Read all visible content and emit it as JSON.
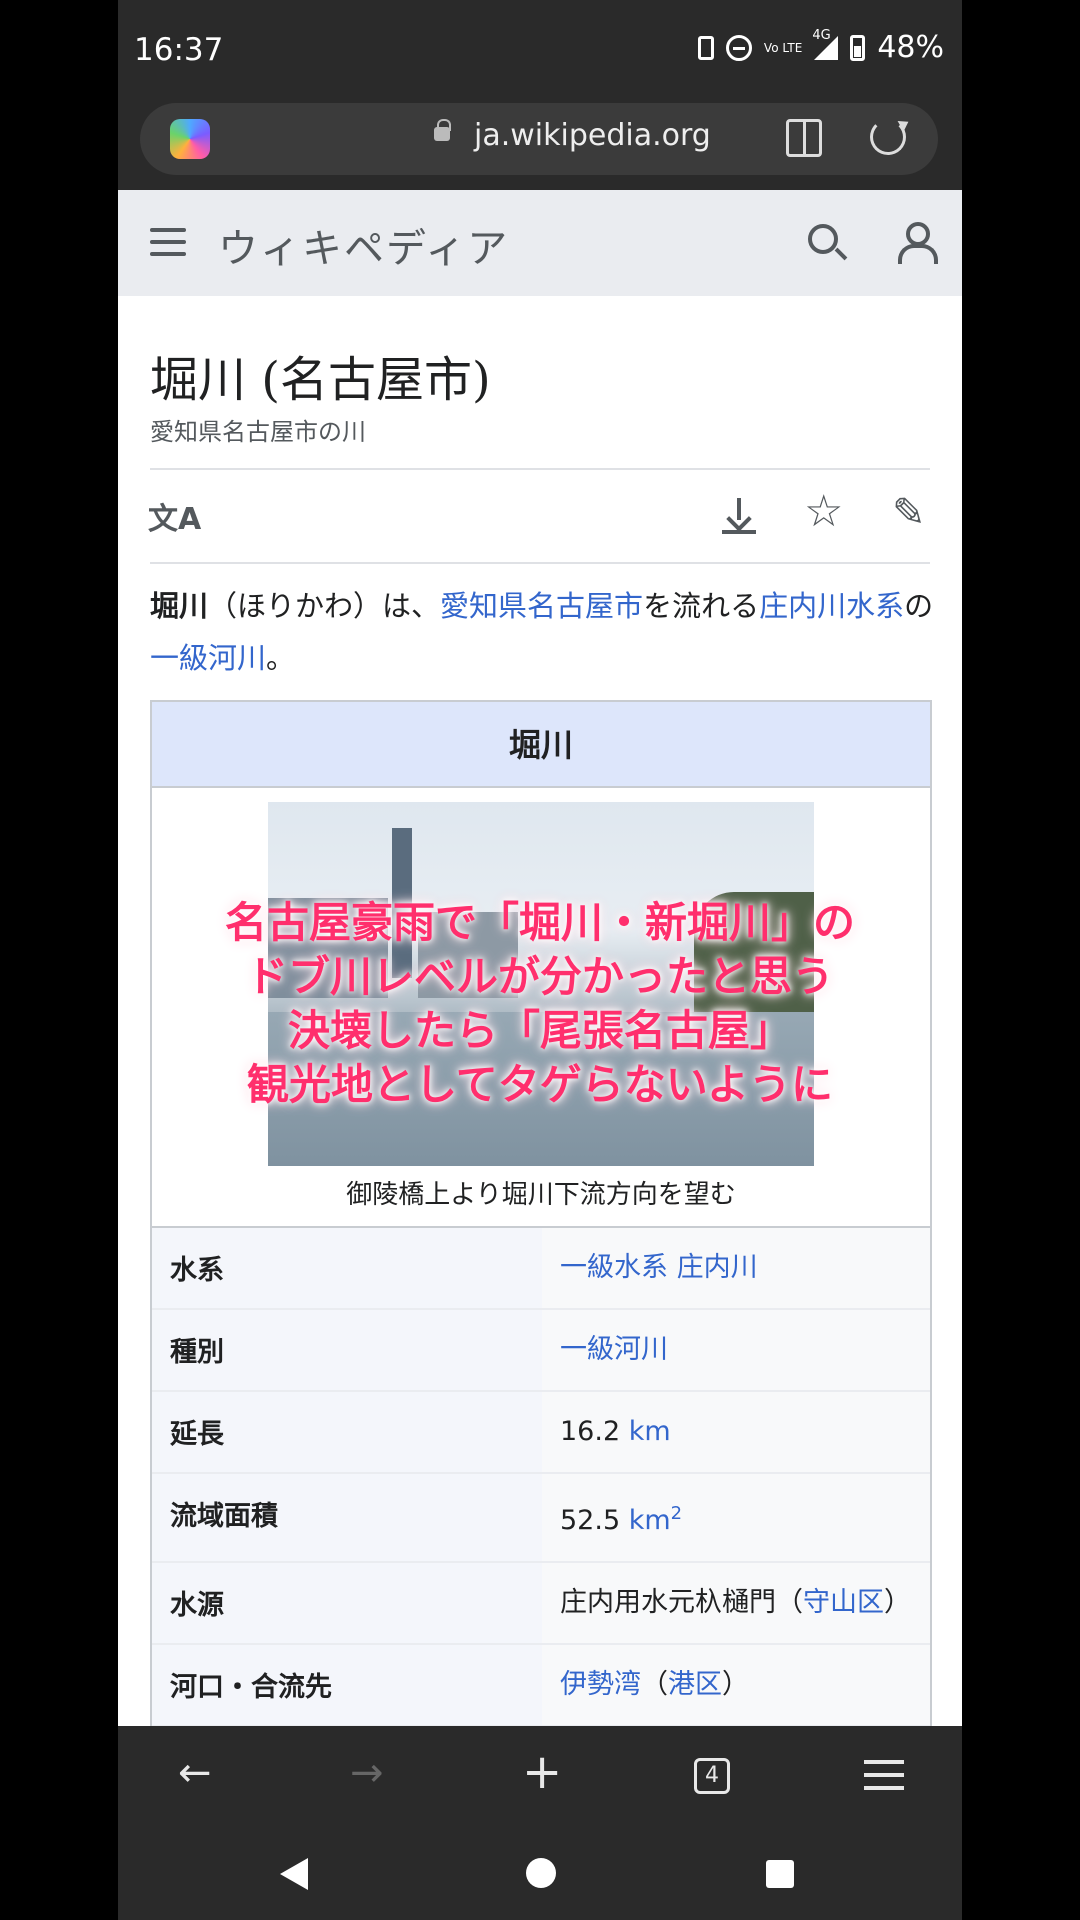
{
  "status": {
    "time": "16:37",
    "network": "4G",
    "volte": "Vo LTE",
    "battery": "48%"
  },
  "browser": {
    "url": "ja.wikipedia.org"
  },
  "wiki": {
    "wordmark": "ウィキペディア",
    "title": "堀川 (名古屋市)",
    "subtitle": "愛知県名古屋市の川",
    "lang_icon": "文A",
    "lead": {
      "bold": "堀川",
      "t1": "（ほりかわ）は、",
      "l1": "愛知県",
      "l2": "名古屋市",
      "t2": "を流れる",
      "l3": "庄内川水系",
      "t3": "の",
      "l4": "一級河川",
      "t4": "。"
    },
    "infobox": {
      "title": "堀川",
      "caption": "御陵橋上より堀川下流方向を望む",
      "rows": [
        {
          "key": "水系",
          "value_link": "一級水系 庄内川"
        },
        {
          "key": "種別",
          "value_link": "一級河川"
        },
        {
          "key": "延長",
          "value_text": "16.2 ",
          "value_link": "km"
        },
        {
          "key": "流域面積",
          "value_text": "52.5 ",
          "value_link": "km",
          "sup": "2"
        },
        {
          "key": "水源",
          "value_text": "庄内用水元杁樋門（",
          "value_link": "守山区",
          "value_tail": "）"
        },
        {
          "key": "河口・合流先",
          "value_link": "伊勢湾",
          "value_text": "（",
          "value_link2": "港区",
          "value_tail": "）"
        }
      ]
    }
  },
  "overlay": {
    "line1": "名古屋豪雨で「堀川・新堀川」の",
    "line2": "ドブ川レベルが分かったと思う",
    "line3": "決壊したら「尾張名古屋」",
    "line4": "観光地としてタゲらないように"
  },
  "toolbar": {
    "back": "←",
    "forward": "→",
    "new_tab": "+",
    "tab_count": "4"
  },
  "icons": {
    "star": "☆",
    "edit": "✎"
  }
}
